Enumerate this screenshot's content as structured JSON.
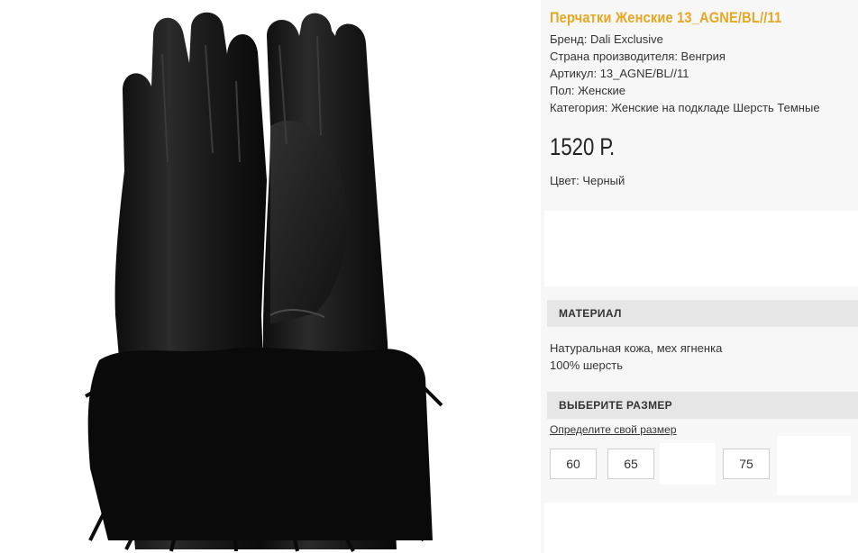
{
  "product": {
    "title": "Перчатки Женские 13_AGNE/BL//11",
    "image_alt": "black-leather-gloves-with-fur-cuff",
    "properties": [
      "Бренд: Dali Exclusive",
      "Страна производителя: Венгрия",
      "Артикул: 13_AGNE/BL//11",
      "Пол: Женские",
      "Категория: Женские на подкладе Шерсть Темные"
    ],
    "price": "1520 Р.",
    "color": "Цвет: Черный"
  },
  "material": {
    "header": "МАТЕРИАЛ",
    "lines": [
      "Натуральная кожа, мех ягненка",
      "100% шерсть"
    ]
  },
  "sizes": {
    "header": "ВЫБЕРИТЕ РАЗМЕР",
    "link": "Определите свой размер",
    "options": [
      "60",
      "65",
      "75"
    ]
  },
  "colors": {
    "title": "#e6a722",
    "header_bg": "#e6e6e6",
    "page_bg": "#f7f7f7"
  }
}
